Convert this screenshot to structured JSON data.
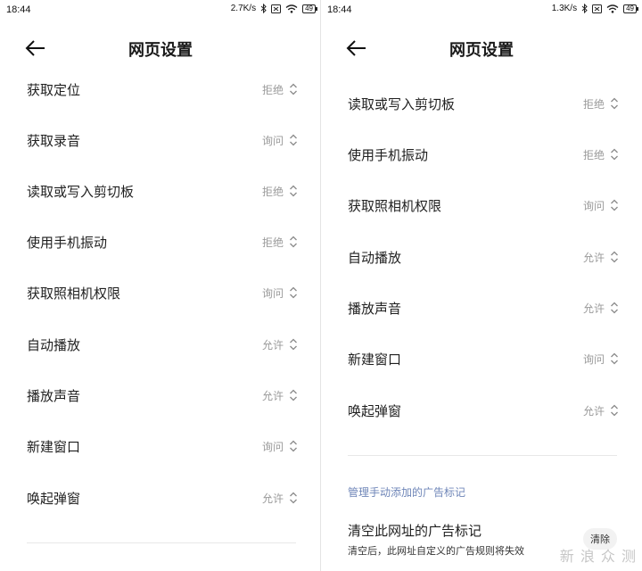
{
  "left": {
    "status": {
      "time": "18:44",
      "speed": "2.7K/s",
      "battery": "49"
    },
    "title": "网页设置",
    "items": [
      {
        "label": "获取定位",
        "value": "拒绝"
      },
      {
        "label": "获取录音",
        "value": "询问"
      },
      {
        "label": "读取或写入剪切板",
        "value": "拒绝"
      },
      {
        "label": "使用手机振动",
        "value": "拒绝"
      },
      {
        "label": "获取照相机权限",
        "value": "询问"
      },
      {
        "label": "自动播放",
        "value": "允许"
      },
      {
        "label": "播放声音",
        "value": "允许"
      },
      {
        "label": "新建窗口",
        "value": "询问"
      },
      {
        "label": "唤起弹窗",
        "value": "允许"
      }
    ]
  },
  "right": {
    "status": {
      "time": "18:44",
      "speed": "1.3K/s",
      "battery": "49"
    },
    "title": "网页设置",
    "items": [
      {
        "label": "读取或写入剪切板",
        "value": "拒绝"
      },
      {
        "label": "使用手机振动",
        "value": "拒绝"
      },
      {
        "label": "获取照相机权限",
        "value": "询问"
      },
      {
        "label": "自动播放",
        "value": "允许"
      },
      {
        "label": "播放声音",
        "value": "允许"
      },
      {
        "label": "新建窗口",
        "value": "询问"
      },
      {
        "label": "唤起弹窗",
        "value": "允许"
      }
    ],
    "section_header": "管理手动添加的广告标记",
    "clear_title": "清空此网址的广告标记",
    "clear_desc": "清空后，此网址自定义的广告规则将失效",
    "clear_button": "清除"
  },
  "watermark": "新 浪 众 测",
  "icons": {
    "back": "back-arrow-icon",
    "chevron": "chevron-updown-icon",
    "bluetooth": "bluetooth-icon",
    "wifi": "wifi-icon",
    "sim": "sim-icon",
    "battery": "battery-icon"
  }
}
